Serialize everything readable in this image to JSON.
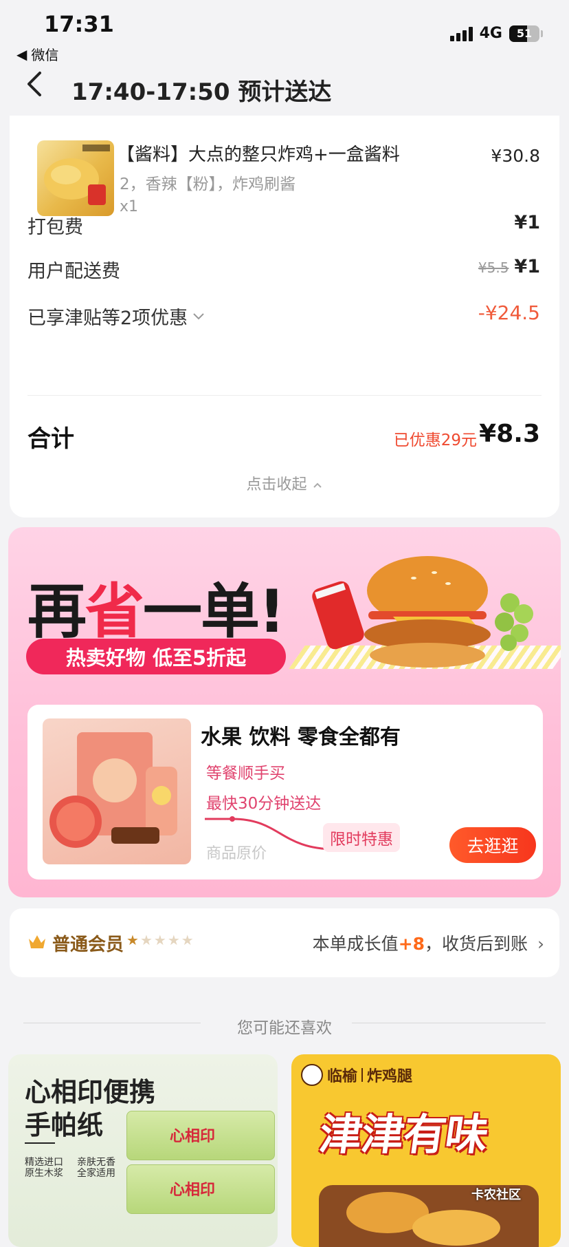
{
  "status_bar": {
    "time": "17:31",
    "back_app": "微信",
    "network": "4G",
    "battery": "51"
  },
  "header": {
    "title": "17:40-17:50 预计送达"
  },
  "order": {
    "item": {
      "name": "【酱料】大点的整只炸鸡+一盒酱料",
      "spec": "2，香辣【粉】，炸鸡刷酱",
      "qty": "x1",
      "price": "¥30.8"
    },
    "rows": {
      "packing_label": "打包费",
      "packing_value": "¥1",
      "delivery_label": "用户配送费",
      "delivery_original": "¥5.5",
      "delivery_value": "¥1",
      "discount_label": "已享津贴等2项优惠",
      "discount_value": "-¥24.5"
    },
    "total_label": "合计",
    "saved": "已优惠29元",
    "total_value": "¥8.3",
    "collapse": "点击收起"
  },
  "promo": {
    "title_black1": "再",
    "title_red": "省",
    "title_black2": "一单!",
    "pill": "热卖好物 低至5折起",
    "inner_title": "水果 饮料 零食全都有",
    "line1": "等餐顺手买",
    "line2": "最快30分钟送达",
    "original_price": "商品原价",
    "tag": "限时特惠",
    "button": "去逛逛"
  },
  "member": {
    "label": "普通会员",
    "stars_filled": 1,
    "stars_total": 5,
    "growth_prefix": "本单成长值",
    "growth_value": "+8",
    "growth_suffix": "，收货后到账"
  },
  "recommend": {
    "title": "您可能还喜欢",
    "card_left": {
      "line1": "心相印便携",
      "line2": "手帕纸",
      "sub1": "精选进口",
      "sub2": "原生木浆",
      "sub3": "亲肤无香",
      "sub4": "全家适用",
      "logo": "心相印"
    },
    "card_right": {
      "brand": "临榆",
      "brand2": "炸鸡腿",
      "headline": "津津有味"
    }
  },
  "watermark": "卡农社区",
  "colors": {
    "accent_red": "#f05a3a",
    "promo_pink": "#f0285a",
    "member_gold": "#c8892a"
  }
}
